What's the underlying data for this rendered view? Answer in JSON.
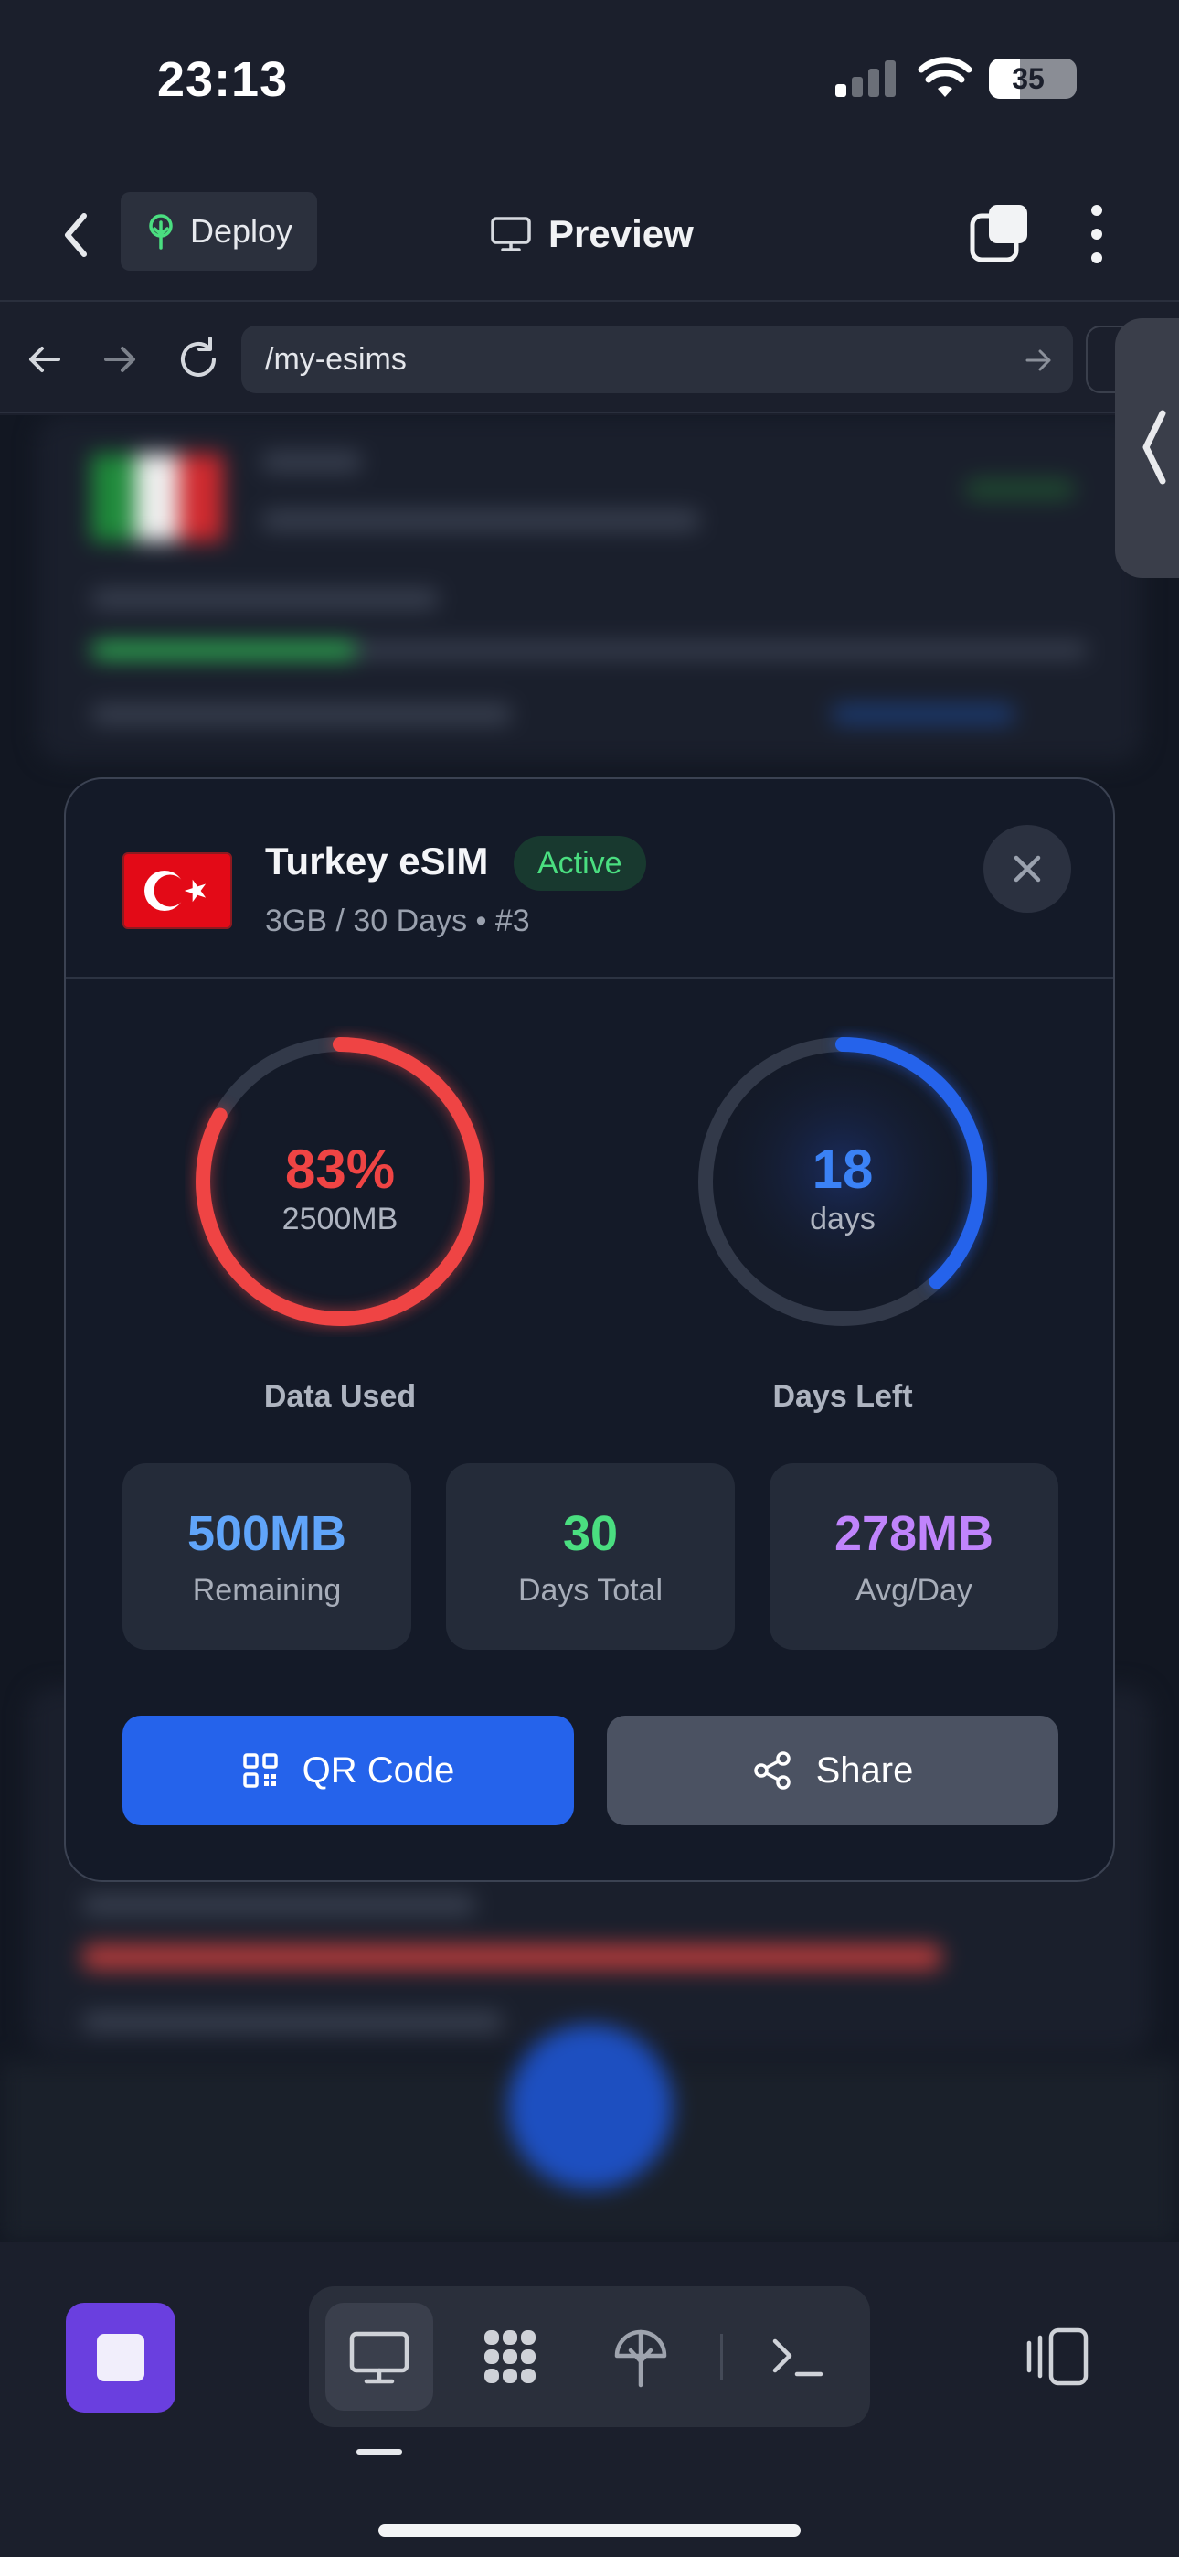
{
  "status_bar": {
    "time": "23:13",
    "battery_level": "35",
    "icons": [
      "cellular-signal-icon",
      "wifi-icon",
      "battery-icon"
    ]
  },
  "topbar": {
    "back_icon": "chevron-left-icon",
    "deploy_label": "Deploy",
    "deploy_icon": "deploy-tree-icon",
    "preview_label": "Preview",
    "preview_icon": "monitor-icon",
    "tabs_icon": "tabs-icon",
    "more_icon": "more-vertical-icon"
  },
  "browser": {
    "url": "/my-esims",
    "icons": [
      "back-arrow-icon",
      "forward-arrow-icon",
      "reload-icon",
      "go-arrow-icon"
    ]
  },
  "modal": {
    "plan_name": "Turkey eSIM",
    "status": "Active",
    "subtitle": "3GB / 30 Days • #3",
    "data_gauge": {
      "value_text": "83%",
      "sub_text": "2500MB",
      "label": "Data Used",
      "fraction": 0.83,
      "color": "#ef4444"
    },
    "days_gauge": {
      "value_text": "18",
      "sub_text": "days",
      "label": "Days Left",
      "fraction": 0.38,
      "color": "#2563eb"
    },
    "stats": [
      {
        "value": "500MB",
        "label": "Remaining",
        "color": "#60a5fa"
      },
      {
        "value": "30",
        "label": "Days Total",
        "color": "#4ade80"
      },
      {
        "value": "278MB",
        "label": "Avg/Day",
        "color": "#c084fc"
      }
    ],
    "qr_button": "QR Code",
    "share_button": "Share"
  },
  "bottom_toolbar": {
    "tools": [
      "monitor-icon",
      "grid-apps-icon",
      "deploy-icon",
      "terminal-icon"
    ],
    "panel_icon": "side-panel-icon"
  },
  "colors": {
    "accent": "#2563eb",
    "danger": "#ef4444",
    "success": "#4ade80",
    "purple": "#c084fc"
  }
}
